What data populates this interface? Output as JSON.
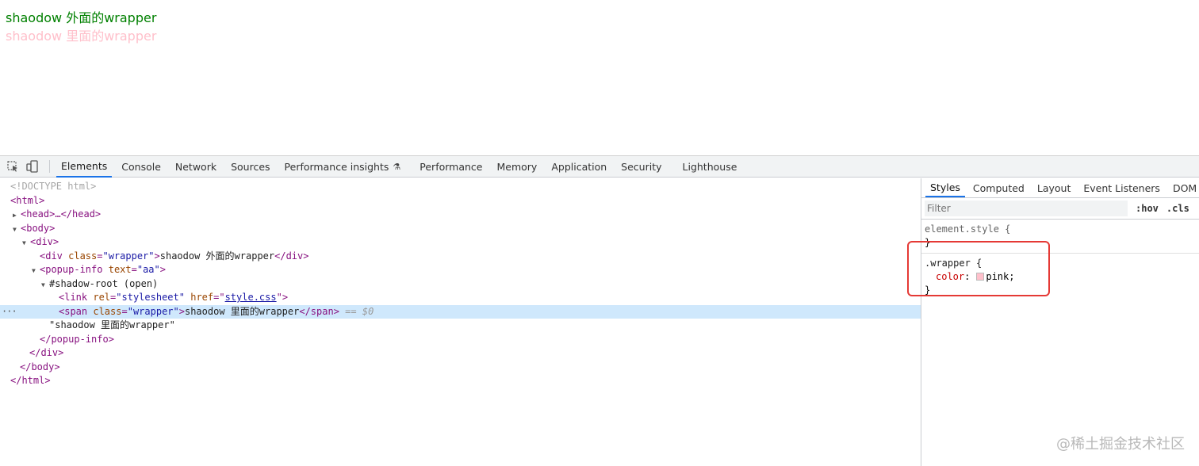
{
  "page": {
    "line1": "shaodow 外面的wrapper",
    "line2": "shaodow 里面的wrapper"
  },
  "toolbar": {
    "tabs": [
      "Elements",
      "Console",
      "Network",
      "Sources",
      "Performance insights",
      "Performance",
      "Memory",
      "Application",
      "Security",
      "Lighthouse"
    ],
    "active_tab": "Elements"
  },
  "tree": {
    "doctype": "<!DOCTYPE html>",
    "html_open": "<html>",
    "head": "<head>…</head>",
    "body_open": "<body>",
    "div_open": "<div>",
    "div_class_attr": "class",
    "div_class_val": "\"wrapper\"",
    "div_text": "shaodow 外面的wrapper",
    "popup_tag": "popup-info",
    "popup_attr": "text",
    "popup_val": "\"aa\"",
    "shadow_root": "#shadow-root (open)",
    "link_rel_attr": "rel",
    "link_rel_val": "\"stylesheet\"",
    "link_href_attr": "href",
    "link_href_val": "style.css",
    "span_class_attr": "class",
    "span_class_val": "\"wrapper\"",
    "span_text": "shaodow 里面的wrapper",
    "span_marker": "== $0",
    "text_node": "\"shaodow 里面的wrapper\"",
    "popup_close": "</popup-info>",
    "div_close": "</div>",
    "body_close": "</body>",
    "html_close": "</html>"
  },
  "styles": {
    "sub_tabs": [
      "Styles",
      "Computed",
      "Layout",
      "Event Listeners",
      "DOM Bre"
    ],
    "filter_placeholder": "Filter",
    "hov": ":hov",
    "cls": ".cls",
    "element_style": "element.style {",
    "rule_selector": ".wrapper {",
    "prop_name": "color",
    "prop_value": "pink;",
    "swatch_color": "#ffc0cb"
  },
  "watermark": "@稀土掘金技术社区"
}
